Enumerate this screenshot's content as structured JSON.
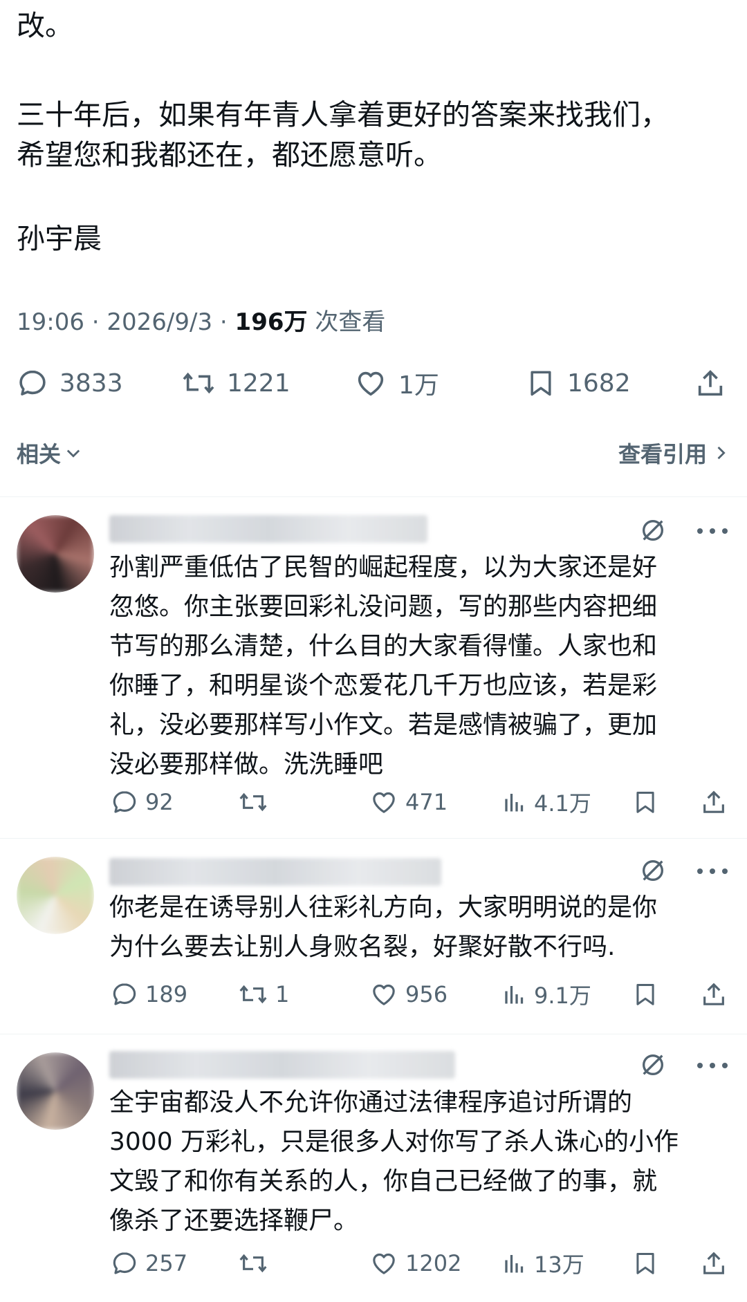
{
  "post": {
    "lines": [
      "改。",
      "三十年后，如果有年青人拿着更好的答案来找我们，",
      "希望您和我都还在，都还愿意听。",
      "孙宇晨"
    ],
    "timestamp": "19:06 · 2026/9/3 · ",
    "views_count": "196万",
    "views_label": " 次查看",
    "actions": {
      "replies": "3833",
      "reposts": "1221",
      "likes": "1万",
      "bookmarks": "1682"
    },
    "related_label": "相关",
    "view_quotes_label": "查看引用"
  },
  "replies": [
    {
      "lines": [
        "孙割严重低估了民智的崛起程度，以为大家还是好",
        "忽悠。你主张要回彩礼没问题，写的那些内容把细",
        "节写的那么清楚，什么目的大家看得懂。人家也和",
        "你睡了，和明星谈个恋爱花几千万也应该，若是彩",
        "礼，没必要那样写小作文。若是感情被骗了，更加",
        "没必要那样做。洗洗睡吧"
      ],
      "replies": "92",
      "reposts": "",
      "likes": "471",
      "views": "4.1万"
    },
    {
      "lines": [
        "你老是在诱导别人往彩礼方向，大家明明说的是你",
        "为什么要去让别人身败名裂，好聚好散不行吗."
      ],
      "replies": "189",
      "reposts": "1",
      "likes": "956",
      "views": "9.1万"
    },
    {
      "lines": [
        "全宇宙都没人不允许你通过法律程序追讨所谓的",
        "3000 万彩礼，只是很多人对你写了杀人诛心的小作",
        "文毁了和你有关系的人，你自己已经做了的事，就",
        "像杀了还要选择鞭尸。"
      ],
      "replies": "257",
      "reposts": "",
      "likes": "1202",
      "views": "13万"
    }
  ],
  "colors": {
    "text": "#0f1419",
    "secondary": "#536471",
    "divider": "#eff3f4"
  }
}
